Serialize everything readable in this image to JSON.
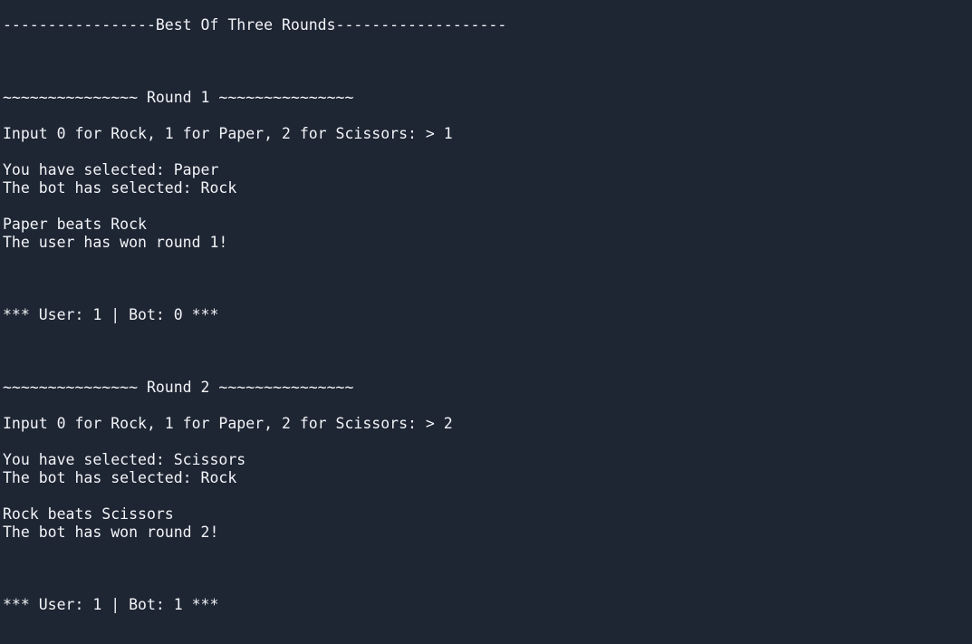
{
  "colors": {
    "background": "#1e2533",
    "foreground": "#f2f4f7"
  },
  "terminal": {
    "header": "-----------------Best Of Three Rounds-------------------",
    "rounds": [
      {
        "title": "~~~~~~~~~~~~~~~ Round 1 ~~~~~~~~~~~~~~~",
        "prompt": "Input 0 for Rock, 1 for Paper, 2 for Scissors: > 1",
        "user_selection": "You have selected: Paper",
        "bot_selection": "The bot has selected: Rock",
        "outcome": "Paper beats Rock",
        "winner": "The user has won round 1!",
        "score": "*** User: 1 | Bot: 0 ***"
      },
      {
        "title": "~~~~~~~~~~~~~~~ Round 2 ~~~~~~~~~~~~~~~",
        "prompt": "Input 0 for Rock, 1 for Paper, 2 for Scissors: > 2",
        "user_selection": "You have selected: Scissors",
        "bot_selection": "The bot has selected: Rock",
        "outcome": "Rock beats Scissors",
        "winner": "The bot has won round 2!",
        "score": "*** User: 1 | Bot: 1 ***"
      }
    ]
  }
}
